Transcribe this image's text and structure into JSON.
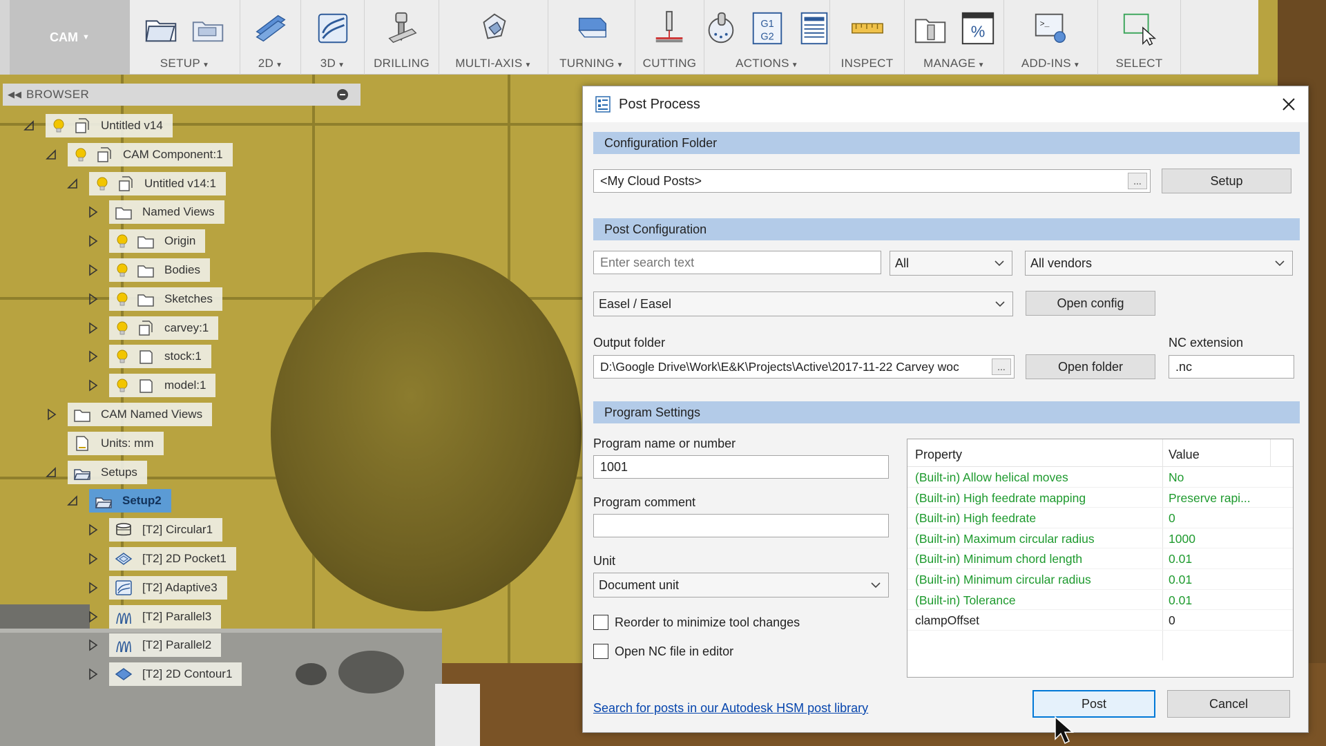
{
  "workspace": {
    "label": "CAM"
  },
  "toolbar": {
    "groups": [
      {
        "label": "SETUP",
        "dropdown": true,
        "icons": [
          "setup-folder-icon",
          "new-setup-icon"
        ]
      },
      {
        "label": "2D",
        "dropdown": true,
        "icons": [
          "2d-layers-icon"
        ]
      },
      {
        "label": "3D",
        "dropdown": true,
        "icons": [
          "3d-adaptive-icon"
        ]
      },
      {
        "label": "DRILLING",
        "dropdown": false,
        "icons": [
          "drill-icon"
        ]
      },
      {
        "label": "MULTI-AXIS",
        "dropdown": true,
        "icons": [
          "multi-axis-icon"
        ]
      },
      {
        "label": "TURNING",
        "dropdown": true,
        "icons": [
          "turning-icon"
        ]
      },
      {
        "label": "CUTTING",
        "dropdown": false,
        "icons": [
          "cutting-icon"
        ]
      },
      {
        "label": "ACTIONS",
        "dropdown": true,
        "icons": [
          "simulate-icon",
          "g1g2-icon",
          "setup-sheet-icon"
        ]
      },
      {
        "label": "INSPECT",
        "dropdown": false,
        "icons": [
          "measure-icon"
        ]
      },
      {
        "label": "MANAGE",
        "dropdown": true,
        "icons": [
          "tool-library-icon",
          "percent-icon"
        ]
      },
      {
        "label": "ADD-INS",
        "dropdown": true,
        "icons": [
          "scripts-icon"
        ]
      },
      {
        "label": "SELECT",
        "dropdown": false,
        "icons": [
          "select-icon"
        ]
      }
    ]
  },
  "browser": {
    "title": "BROWSER",
    "tree": [
      {
        "label": "Untitled v14",
        "level": 0,
        "toggle": "open",
        "bulb": true,
        "icon": "component-icon"
      },
      {
        "label": "CAM Component:1",
        "level": 1,
        "toggle": "open",
        "bulb": true,
        "icon": "component-icon"
      },
      {
        "label": "Untitled v14:1",
        "level": 2,
        "toggle": "open",
        "bulb": true,
        "icon": "component-icon"
      },
      {
        "label": "Named Views",
        "level": 3,
        "toggle": "closed",
        "bulb": false,
        "icon": "folder-icon"
      },
      {
        "label": "Origin",
        "level": 3,
        "toggle": "closed",
        "bulb": true,
        "icon": "folder-icon"
      },
      {
        "label": "Bodies",
        "level": 3,
        "toggle": "closed",
        "bulb": true,
        "icon": "folder-icon"
      },
      {
        "label": "Sketches",
        "level": 3,
        "toggle": "closed",
        "bulb": true,
        "icon": "folder-icon"
      },
      {
        "label": "carvey:1",
        "level": 3,
        "toggle": "closed",
        "bulb": true,
        "icon": "component-icon"
      },
      {
        "label": "stock:1",
        "level": 3,
        "toggle": "closed",
        "bulb": true,
        "icon": "body-icon"
      },
      {
        "label": "model:1",
        "level": 3,
        "toggle": "closed",
        "bulb": true,
        "icon": "body-icon"
      },
      {
        "label": "CAM Named Views",
        "level": 1,
        "toggle": "closed",
        "bulb": false,
        "icon": "folder-icon"
      },
      {
        "label": "Units: mm",
        "level": 1,
        "toggle": "none",
        "bulb": false,
        "icon": "document-icon"
      },
      {
        "label": "Setups",
        "level": 1,
        "toggle": "open",
        "bulb": false,
        "icon": "setups-icon"
      },
      {
        "label": "Setup2",
        "level": 2,
        "toggle": "open",
        "bulb": false,
        "icon": "setups-icon",
        "selected": true
      },
      {
        "label": "[T2] Circular1",
        "level": 3,
        "toggle": "closed",
        "bulb": false,
        "icon": "circular-icon"
      },
      {
        "label": "[T2] 2D Pocket1",
        "level": 3,
        "toggle": "closed",
        "bulb": false,
        "icon": "pocket-icon"
      },
      {
        "label": "[T2] Adaptive3",
        "level": 3,
        "toggle": "closed",
        "bulb": false,
        "icon": "adaptive-icon"
      },
      {
        "label": "[T2] Parallel3",
        "level": 3,
        "toggle": "closed",
        "bulb": false,
        "icon": "parallel-icon"
      },
      {
        "label": "[T2] Parallel2",
        "level": 3,
        "toggle": "closed",
        "bulb": false,
        "icon": "parallel-icon"
      },
      {
        "label": "[T2] 2D Contour1",
        "level": 3,
        "toggle": "closed",
        "bulb": false,
        "icon": "contour-icon"
      }
    ]
  },
  "dialog": {
    "title": "Post Process",
    "config_folder": {
      "section": "Configuration Folder",
      "value": "<My Cloud Posts>",
      "browse": "...",
      "setup_button": "Setup"
    },
    "post_config": {
      "section": "Post Configuration",
      "search_placeholder": "Enter search text",
      "filter_value": "All",
      "vendor_value": "All vendors",
      "post_value": "Easel / Easel",
      "open_config_button": "Open config"
    },
    "output": {
      "label": "Output folder",
      "value": "D:\\Google Drive\\Work\\E&K\\Projects\\Active\\2017-11-22 Carvey woc",
      "browse": "...",
      "open_folder_button": "Open folder",
      "nc_label": "NC extension",
      "nc_value": ".nc"
    },
    "program": {
      "section": "Program Settings",
      "name_label": "Program name or number",
      "name_value": "1001",
      "comment_label": "Program comment",
      "comment_value": "",
      "unit_label": "Unit",
      "unit_value": "Document unit",
      "reorder_label": "Reorder to minimize tool changes",
      "reorder_checked": false,
      "open_nc_label": "Open NC file in editor",
      "open_nc_checked": false
    },
    "properties": {
      "header_property": "Property",
      "header_value": "Value",
      "rows": [
        {
          "name": "(Built-in) Allow helical moves",
          "value": "No",
          "builtin": true
        },
        {
          "name": "(Built-in) High feedrate mapping",
          "value": "Preserve rapi...",
          "builtin": true
        },
        {
          "name": "(Built-in) High feedrate",
          "value": "0",
          "builtin": true
        },
        {
          "name": "(Built-in) Maximum circular radius",
          "value": "1000",
          "builtin": true
        },
        {
          "name": "(Built-in) Minimum chord length",
          "value": "0.01",
          "builtin": true
        },
        {
          "name": "(Built-in) Minimum circular radius",
          "value": "0.01",
          "builtin": true
        },
        {
          "name": "(Built-in) Tolerance",
          "value": "0.01",
          "builtin": true
        },
        {
          "name": "clampOffset",
          "value": "0",
          "builtin": false
        }
      ]
    },
    "link": "Search for posts in our Autodesk HSM post library",
    "post_button": "Post",
    "cancel_button": "Cancel"
  },
  "colors": {
    "section_bg": "#b3cbe8",
    "builtin_text": "#1e9a2e",
    "selection": "#5b9bd5",
    "primary_border": "#0078d7",
    "link": "#0645ad"
  }
}
